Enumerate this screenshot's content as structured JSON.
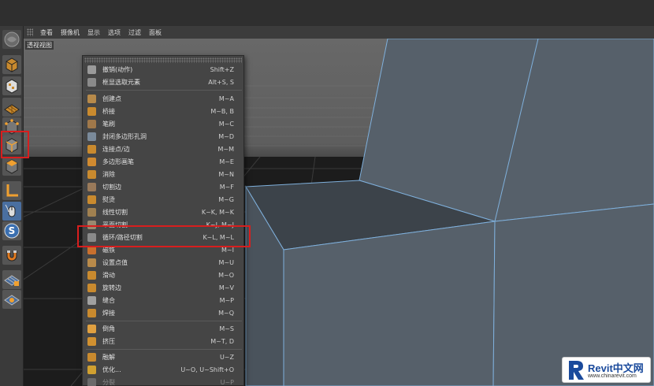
{
  "menubar": {
    "items": [
      "查看",
      "摄像机",
      "显示",
      "选项",
      "过滤",
      "面板"
    ]
  },
  "viewport": {
    "label": "透视视图"
  },
  "context_menu": {
    "items": [
      {
        "label": "撤销(动作)",
        "shortcut": "Shift+Z",
        "icon": "undo-icon"
      },
      {
        "label": "框显选取元素",
        "shortcut": "Alt+S, S",
        "icon": "frame-selected-icon"
      },
      {
        "label": "创建点",
        "shortcut": "M~A",
        "icon": "create-point-icon"
      },
      {
        "label": "桥接",
        "shortcut": "M~B, B",
        "icon": "bridge-icon"
      },
      {
        "label": "笔刷",
        "shortcut": "M~C",
        "icon": "brush-icon"
      },
      {
        "label": "封闭多边形孔洞",
        "shortcut": "M~D",
        "icon": "close-polygon-hole-icon"
      },
      {
        "label": "连接点/边",
        "shortcut": "M~M",
        "icon": "connect-points-edges-icon"
      },
      {
        "label": "多边形画笔",
        "shortcut": "M~E",
        "icon": "polygon-pen-icon"
      },
      {
        "label": "消除",
        "shortcut": "M~N",
        "icon": "dissolve-icon"
      },
      {
        "label": "切割边",
        "shortcut": "M~F",
        "icon": "edge-cut-icon"
      },
      {
        "label": "熨烫",
        "shortcut": "M~G",
        "icon": "iron-icon"
      },
      {
        "label": "线性切割",
        "shortcut": "K~K, M~K",
        "icon": "line-cut-icon"
      },
      {
        "label": "平面切割",
        "shortcut": "K~J, M~J",
        "icon": "plane-cut-icon"
      },
      {
        "label": "循环/路径切割",
        "shortcut": "K~L, M~L",
        "icon": "loop-path-cut-icon"
      },
      {
        "label": "磁铁",
        "shortcut": "M~I",
        "icon": "magnet-icon"
      },
      {
        "label": "设置点值",
        "shortcut": "M~U",
        "icon": "set-point-value-icon"
      },
      {
        "label": "滑动",
        "shortcut": "M~O",
        "icon": "slide-icon"
      },
      {
        "label": "旋转边",
        "shortcut": "M~V",
        "icon": "spin-edge-icon"
      },
      {
        "label": "缝合",
        "shortcut": "M~P",
        "icon": "stitch-icon"
      },
      {
        "label": "焊接",
        "shortcut": "M~Q",
        "icon": "weld-icon"
      },
      {
        "label": "倒角",
        "shortcut": "M~S",
        "icon": "bevel-icon"
      },
      {
        "label": "挤压",
        "shortcut": "M~T, D",
        "icon": "extrude-icon"
      },
      {
        "label": "融解",
        "shortcut": "U~Z",
        "icon": "melt-icon"
      },
      {
        "label": "优化...",
        "shortcut": "U~O, U~Shift+O",
        "icon": "optimize-icon"
      },
      {
        "label": "分裂",
        "shortcut": "U~P",
        "icon": "split-icon",
        "disabled": true
      }
    ]
  },
  "left_toolbar": {
    "icons": [
      "cinema-logo-icon",
      "model-mode-icon",
      "texture-mode-icon",
      "workplane-icon",
      "points-mode-icon",
      "edges-mode-icon",
      "polygons-mode-icon",
      "axis-icon",
      "tweak-mode-icon",
      "snap-icon",
      "magnet-tool-icon",
      "lock-workplane-icon",
      "planar-workplane-icon"
    ]
  },
  "watermark": {
    "brand": "Revit中文网",
    "url": "www.chinarevit.com"
  },
  "colors": {
    "highlight": "#d81e1e",
    "mesh_face": "#56606a",
    "mesh_edge": "#7fb0dc",
    "menu_bg": "#454545"
  }
}
